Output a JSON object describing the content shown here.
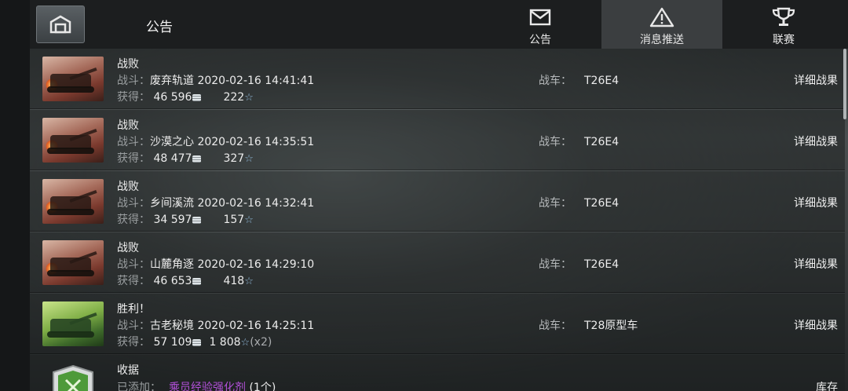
{
  "header": {
    "title": "公告",
    "tabs": [
      {
        "label": "公告",
        "icon": "envelope-icon",
        "active": false
      },
      {
        "label": "消息推送",
        "icon": "warning-triangle-icon",
        "active": true
      },
      {
        "label": "联赛",
        "icon": "trophy-icon",
        "active": false
      }
    ]
  },
  "labels": {
    "battle": "战斗：",
    "earned": "获得：",
    "vehicle": "战车：",
    "details": "详细战果",
    "added": "已添加：",
    "stock": "库存"
  },
  "battles": [
    {
      "result": "战败",
      "map": "废弃轨道",
      "datetime": "2020-02-16 14:41:41",
      "credits": "46 596",
      "xp": "222",
      "multiplier": "",
      "vehicle": "T26E4",
      "thumb": "defeat"
    },
    {
      "result": "战败",
      "map": "沙漠之心",
      "datetime": "2020-02-16 14:35:51",
      "credits": "48 477",
      "xp": "327",
      "multiplier": "",
      "vehicle": "T26E4",
      "thumb": "defeat"
    },
    {
      "result": "战败",
      "map": "乡间溪流",
      "datetime": "2020-02-16 14:32:41",
      "credits": "34 597",
      "xp": "157",
      "multiplier": "",
      "vehicle": "T26E4",
      "thumb": "defeat"
    },
    {
      "result": "战败",
      "map": "山麓角逐",
      "datetime": "2020-02-16 14:29:10",
      "credits": "46 653",
      "xp": "418",
      "multiplier": "",
      "vehicle": "T26E4",
      "thumb": "defeat"
    },
    {
      "result": "胜利！",
      "map": "古老秘境",
      "datetime": "2020-02-16 14:25:11",
      "credits": "57 109",
      "xp": "1 808",
      "multiplier": "(x2)",
      "vehicle": "T28原型车",
      "thumb": "victory"
    }
  ],
  "receipt": {
    "title": "收据",
    "item": "乘员经验强化剂",
    "count": "(1个)"
  },
  "colors": {
    "item_highlight": "#b04fd6",
    "xp_star": "#8fb8d8",
    "active_tab_bg": "#3b3e40"
  }
}
